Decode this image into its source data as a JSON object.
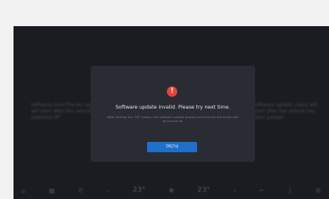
{
  "dialog": {
    "icon": "warning-icon",
    "title": "Software update invalid. Please try next time.",
    "description": "After clicking the \"OK\" button, the software update process will end and the screen will be turned off.",
    "ok_label": "OK(7s)"
  },
  "background": {
    "left_text": "Software Over-The-Air update will start after the vehicle is powered off",
    "right_text": "Software update check will start after the vehicle has been parked"
  },
  "dock": {
    "left_temp": "23°",
    "right_temp": "23°"
  },
  "colors": {
    "warning": "#e8433d",
    "button": "#1e70c9",
    "dialog_bg": "#2a2c34",
    "screen_bg": "#1b1c22"
  }
}
